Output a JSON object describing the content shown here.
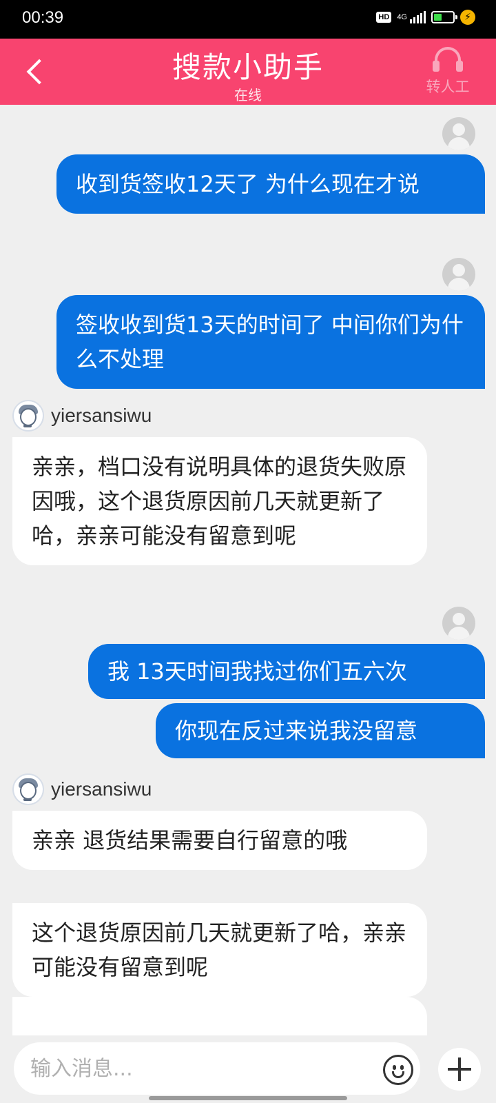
{
  "status_bar": {
    "time": "00:39",
    "hd": "HD",
    "network": "4G"
  },
  "header": {
    "title": "搜款小助手",
    "subtitle": "在线",
    "agent_label": "转人工"
  },
  "messages": [
    {
      "from": "user",
      "text": "收到货签收12天了  为什么现在才说"
    },
    {
      "from": "user",
      "text": "签收收到货13天的时间了    中间你们为什么不处理"
    },
    {
      "from": "agent",
      "name": "yiersansiwu",
      "text": "亲亲，档口没有说明具体的退货失败原因哦，这个退货原因前几天就更新了哈，亲亲可能没有留意到呢"
    },
    {
      "from": "user",
      "text": "我  13天时间我找过你们五六次"
    },
    {
      "from": "user",
      "text": "你现在反过来说我没留意"
    },
    {
      "from": "agent",
      "name": "yiersansiwu",
      "text": "亲亲    退货结果需要自行留意的哦"
    },
    {
      "from": "agent",
      "text": "这个退货原因前几天就更新了哈，亲亲可能没有留意到呢"
    }
  ],
  "input": {
    "placeholder": "输入消息..."
  },
  "colors": {
    "header_bg": "#f8446f",
    "outgoing_bubble": "#0a72e0",
    "incoming_bubble": "#ffffff",
    "chat_bg": "#efefef"
  }
}
